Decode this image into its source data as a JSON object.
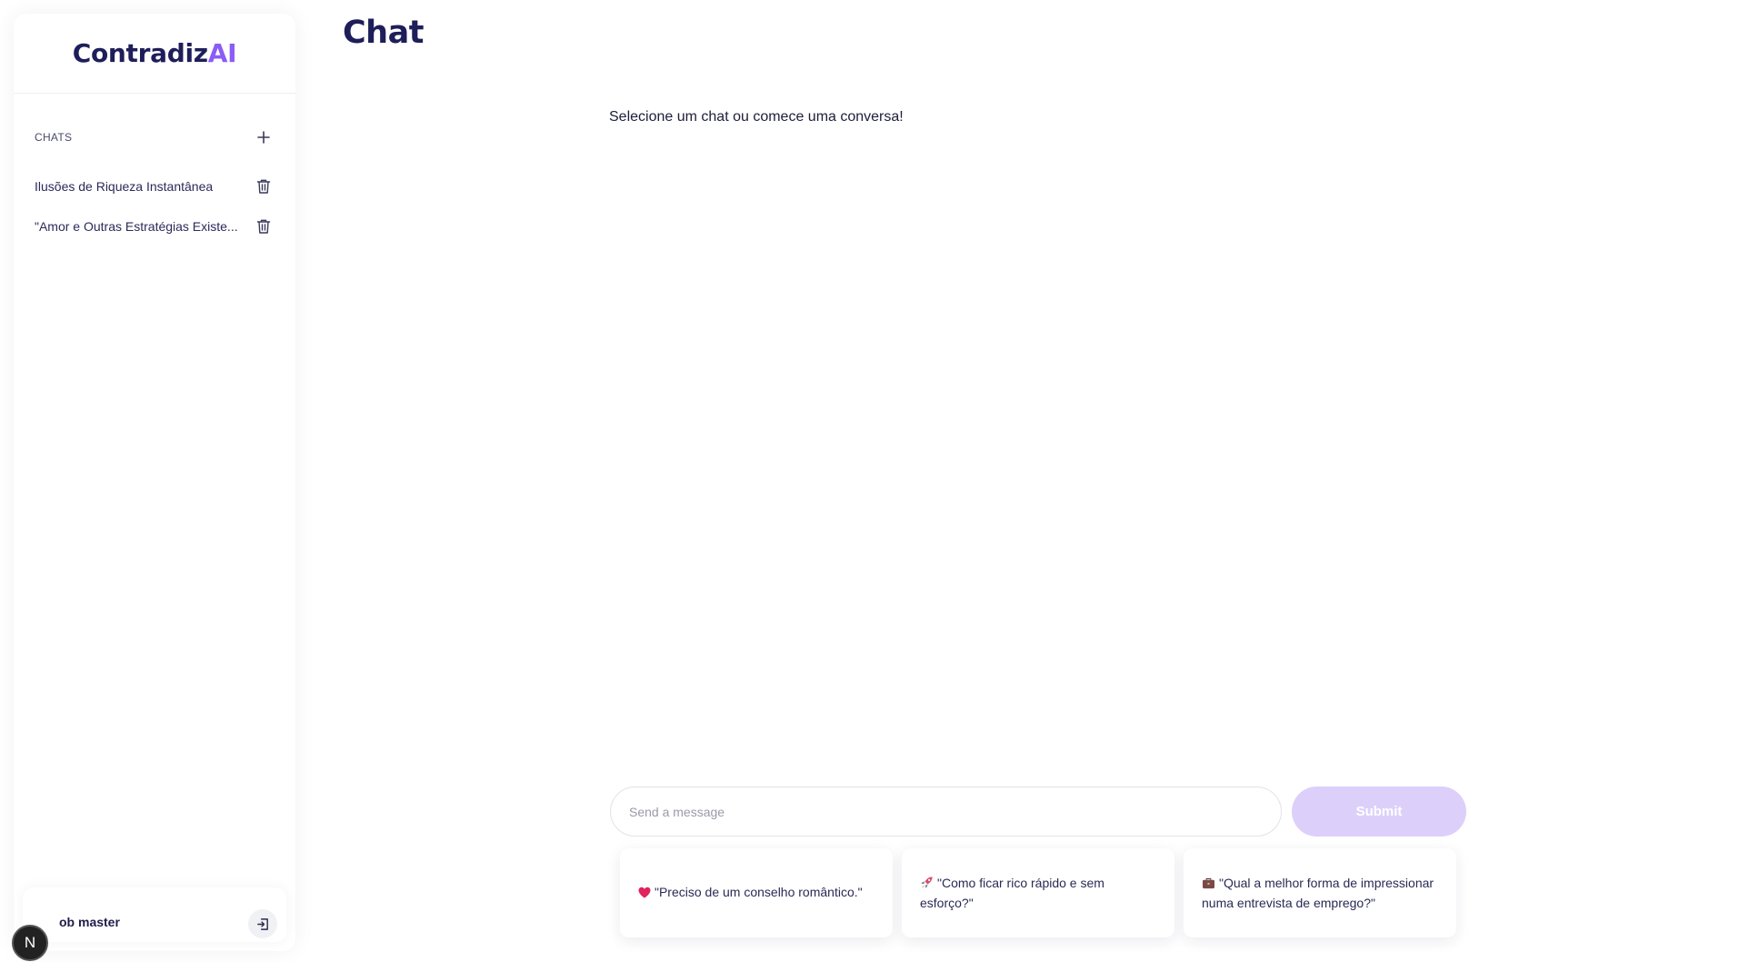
{
  "brand": {
    "name_main": "Contradiz",
    "name_accent": "AI",
    "accent_color": "#8b5cf6"
  },
  "sidebar": {
    "chats_title": "CHATS",
    "new_chat_icon": "plus-icon",
    "items": [
      {
        "label": "Ilusões de Riqueza Instantânea",
        "icon": "trash-icon"
      },
      {
        "label": "\"Amor e Outras Estratégias Existe...",
        "icon": "trash-icon"
      }
    ]
  },
  "user": {
    "avatar_letter": "N",
    "name": "ob master",
    "logout_icon": "logout-icon"
  },
  "main": {
    "title": "Chat",
    "empty_message": "Selecione um chat ou comece uma conversa!"
  },
  "composer": {
    "placeholder": "Send a message",
    "submit_label": "Submit",
    "submit_color": "#dcd0fb"
  },
  "suggestions": [
    {
      "icon": "heart-icon",
      "text": "\"Preciso de um conselho romântico.\""
    },
    {
      "icon": "rocket-icon",
      "text": "\"Como ficar rico rápido e sem esforço?\""
    },
    {
      "icon": "briefcase-icon",
      "text": "\"Qual a melhor forma de impressionar numa entrevista de emprego?\""
    }
  ]
}
